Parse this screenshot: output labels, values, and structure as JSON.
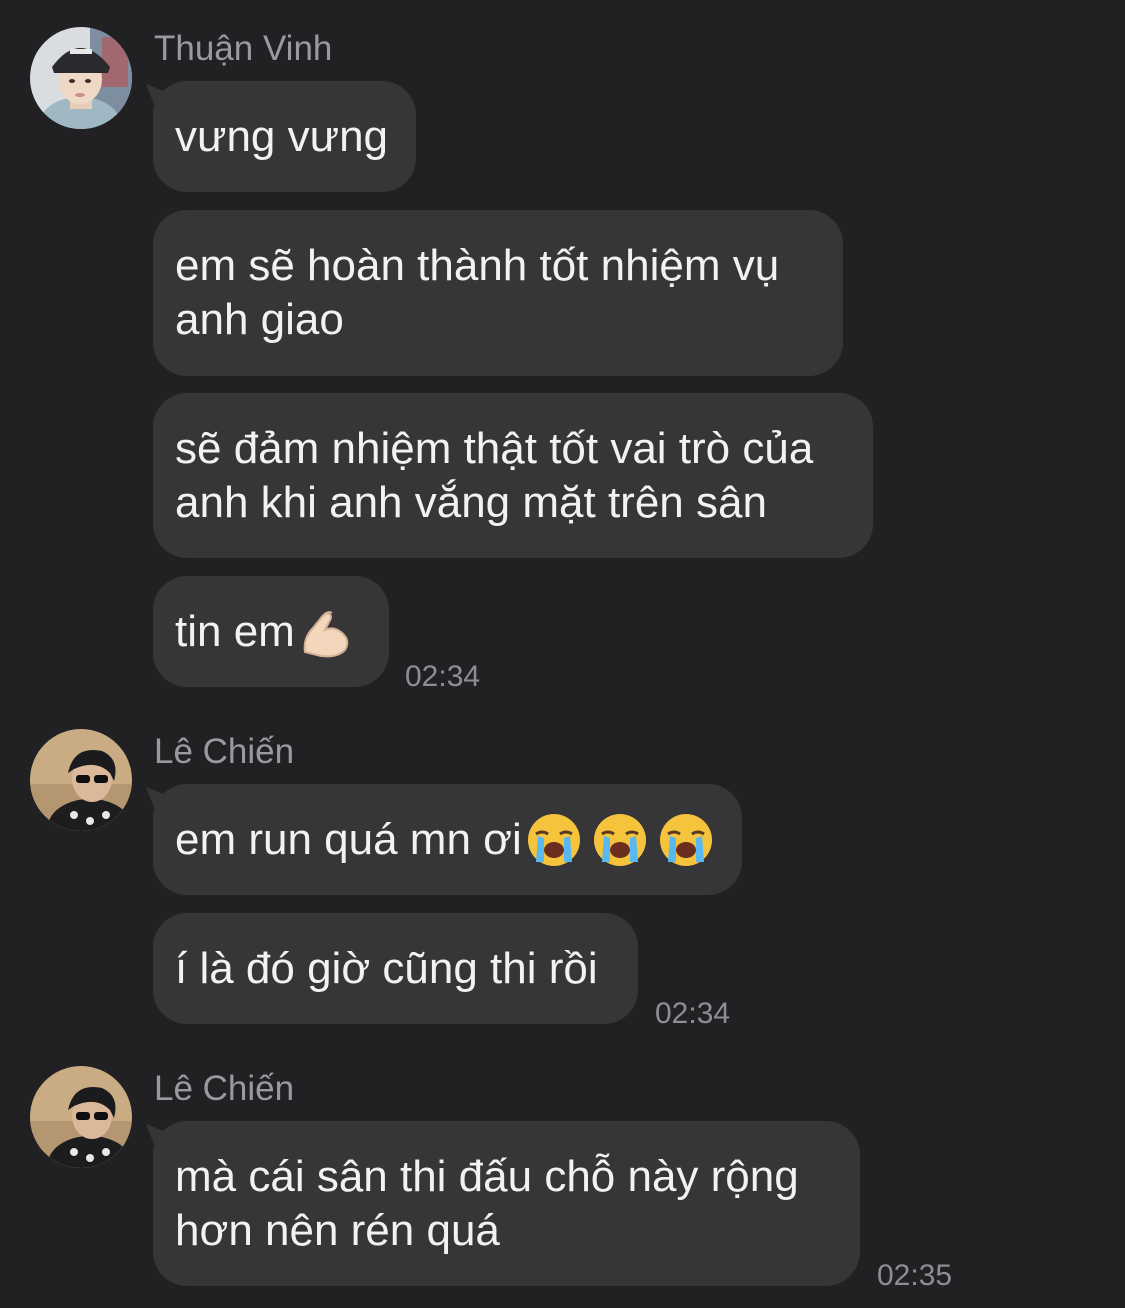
{
  "chat": {
    "groups": [
      {
        "sender": "Thuận Vinh",
        "avatar_icon": "person-avatar-icon",
        "messages": [
          {
            "text": "vưng vưng"
          },
          {
            "text": "em sẽ hoàn thành tốt nhiệm vụ\nanh giao"
          },
          {
            "text": "sẽ đảm nhiệm thật tốt vai trò của\nanh khi anh vắng mặt trên sân"
          },
          {
            "text": "tin em",
            "emoji": "flexed-biceps-icon"
          }
        ],
        "time": "02:34"
      },
      {
        "sender": "Lê Chiến",
        "avatar_icon": "person-avatar-icon",
        "messages": [
          {
            "text": "em run quá mn ơi",
            "emoji": "loudly-crying-face-icon x3"
          },
          {
            "text": "í là đó giờ cũng thi rồi"
          }
        ],
        "time": "02:34"
      },
      {
        "sender": "Lê Chiến",
        "avatar_icon": "person-avatar-icon",
        "messages": [
          {
            "text": "mà cái sân thi đấu chỗ này rộng\nhơn nên rén quá"
          }
        ],
        "time": "02:35"
      }
    ]
  },
  "colors": {
    "background": "#212123",
    "bubble": "#363638",
    "text": "#f2f2f2",
    "meta": "#9a9a9e"
  }
}
